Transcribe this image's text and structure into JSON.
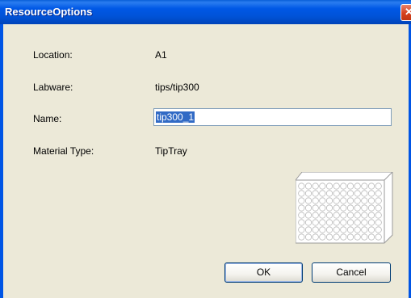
{
  "window": {
    "title": "ResourceOptions",
    "close_glyph": "✕"
  },
  "form": {
    "location_label": "Location:",
    "location_value": "A1",
    "labware_label": "Labware:",
    "labware_value": "tips/tip300",
    "name_label": "Name:",
    "name_value": "tip300_1",
    "material_type_label": "Material Type:",
    "material_type_value": "TipTray"
  },
  "preview": {
    "icon": "tip-tray-icon",
    "rows": 8,
    "columns": 12
  },
  "buttons": {
    "ok_label": "OK",
    "cancel_label": "Cancel"
  },
  "colors": {
    "titlebar": "#0058E6",
    "dialog_background": "#ECE9D8",
    "selection": "#316AC5",
    "input_border": "#7F9DB9"
  }
}
